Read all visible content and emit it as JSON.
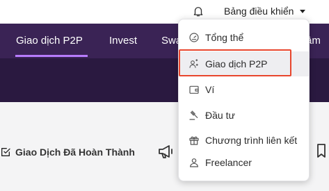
{
  "header": {
    "dashboard_label": "Bảng điều khiển"
  },
  "nav": {
    "items": [
      "Giao dịch P2P",
      "Invest",
      "Swa",
      "âm"
    ]
  },
  "content": {
    "completed_label": "Giao Dịch Đã Hoàn Thành"
  },
  "dropdown": {
    "items": [
      {
        "label": "Tổng thể",
        "icon": "gauge-icon"
      },
      {
        "label": "Giao dịch P2P",
        "icon": "users-swap-icon"
      },
      {
        "label": "Ví",
        "icon": "wallet-icon"
      },
      {
        "label": "Đầu tư",
        "icon": "gavel-icon"
      },
      {
        "label": "Chương trình liên kết",
        "icon": "gift-icon"
      },
      {
        "label": "Freelancer",
        "icon": "user-icon"
      }
    ],
    "active_index": 1
  },
  "colors": {
    "nav_bg": "#3a2355",
    "banner_bg": "#2a1940",
    "highlight_border": "#e8462d",
    "nav_underline": "#b77cff"
  }
}
